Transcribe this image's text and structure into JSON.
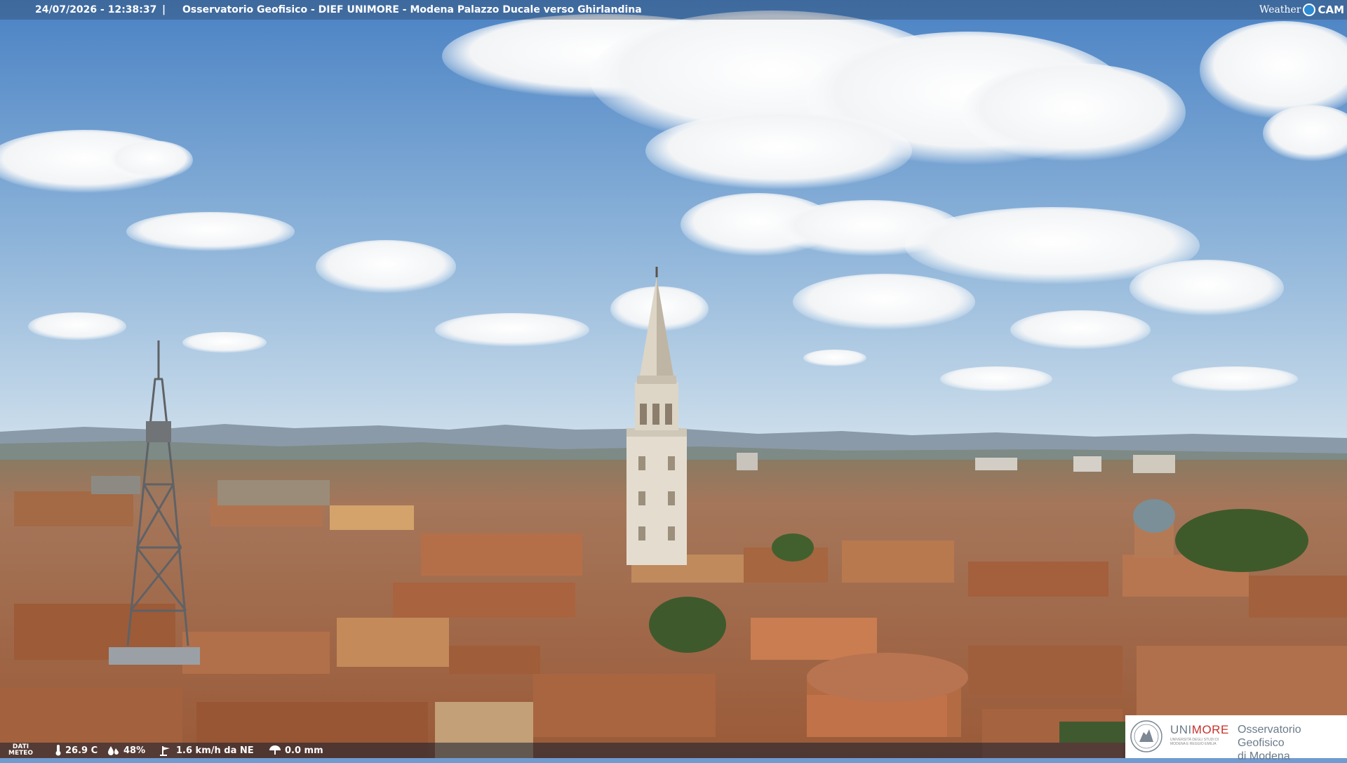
{
  "overlay": {
    "timestamp": "24/07/2026 - 12:38:37",
    "separator": "|",
    "title": "Osservatorio Geofisico - DIEF UNIMORE - Modena Palazzo Ducale verso Ghirlandina"
  },
  "brand": {
    "left": "Weather",
    "right": "CAM"
  },
  "weather": {
    "label_line1": "DATI",
    "label_line2": "METEO",
    "temperature": "26.9 C",
    "humidity": "48%",
    "wind": "1.6 km/h da NE",
    "rain": "0.0 mm"
  },
  "logo": {
    "name_first": "UNI",
    "name_second": "MORE",
    "subtitle": "UNIVERSITÀ DEGLI STUDI DI MODENA E REGGIO EMILIA",
    "org_line1": "Osservatorio Geofisico",
    "org_line2": "di Modena"
  },
  "colors": {
    "sky_top": "#4f86c6",
    "sky_horizon": "#c9dcea",
    "roofs": "#b06a42",
    "unimore_red": "#c7312b"
  }
}
